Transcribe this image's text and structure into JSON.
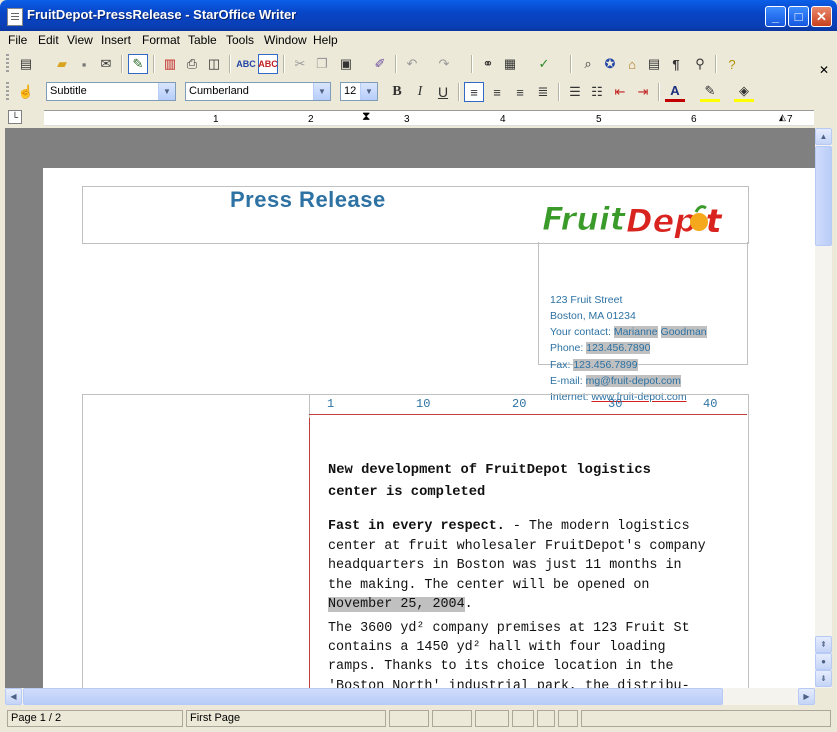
{
  "window": {
    "title": "FruitDepot-PressRelease - StarOffice Writer"
  },
  "menu": {
    "items": [
      "File",
      "Edit",
      "View",
      "Insert",
      "Format",
      "Table",
      "Tools",
      "Window",
      "Help"
    ]
  },
  "format_bar": {
    "style": "Subtitle",
    "font": "Cumberland",
    "size": "12"
  },
  "ruler": {
    "numbers": [
      "1",
      "2",
      "3",
      "4",
      "5",
      "6",
      "7"
    ]
  },
  "document": {
    "press_title": "Press Release",
    "logo_text": "FruitDepot",
    "address": {
      "street": "123 Fruit Street",
      "city": "Boston, MA 01234",
      "contact_label": "Your contact:",
      "contact_first": "Marianne",
      "contact_last": "Goodman",
      "phone_label": "Phone:",
      "phone": "123.456.7890",
      "fax_label": "Fax:",
      "fax": "123.456.7899",
      "email_label": "E-mail:",
      "email": "mg@fruit-depot.com",
      "internet_label": "Internet:",
      "internet": "www.fruit-depot.com"
    },
    "line_numbers": [
      "1",
      "10",
      "20",
      "30",
      "40"
    ],
    "heading_line1": "New development of FruitDepot logistics",
    "heading_line2": "center is completed",
    "para1_lead": "Fast in every respect.",
    "para1_l1_rest": " - The modern logistics",
    "para1_l2": "center at fruit wholesaler FruitDepot's company",
    "para1_l3": "headquarters in Boston was just 11 months in",
    "para1_l4": "the making. The center will be opened on",
    "para1_date": "November 25, 2004",
    "para1_end": ".",
    "para2_l1": "The 3600 yd² company premises at 123 Fruit St",
    "para2_l2": "contains a 1450 yd² hall with four loading",
    "para2_l3": "ramps. Thanks to its choice location in the",
    "para2_l4": "'Boston North' industrial park, the distribu-"
  },
  "status": {
    "page": "Page 1 / 2",
    "style": "First Page"
  },
  "colors": {
    "accent": "#2d72a3",
    "title_bar": "#0846c7"
  }
}
